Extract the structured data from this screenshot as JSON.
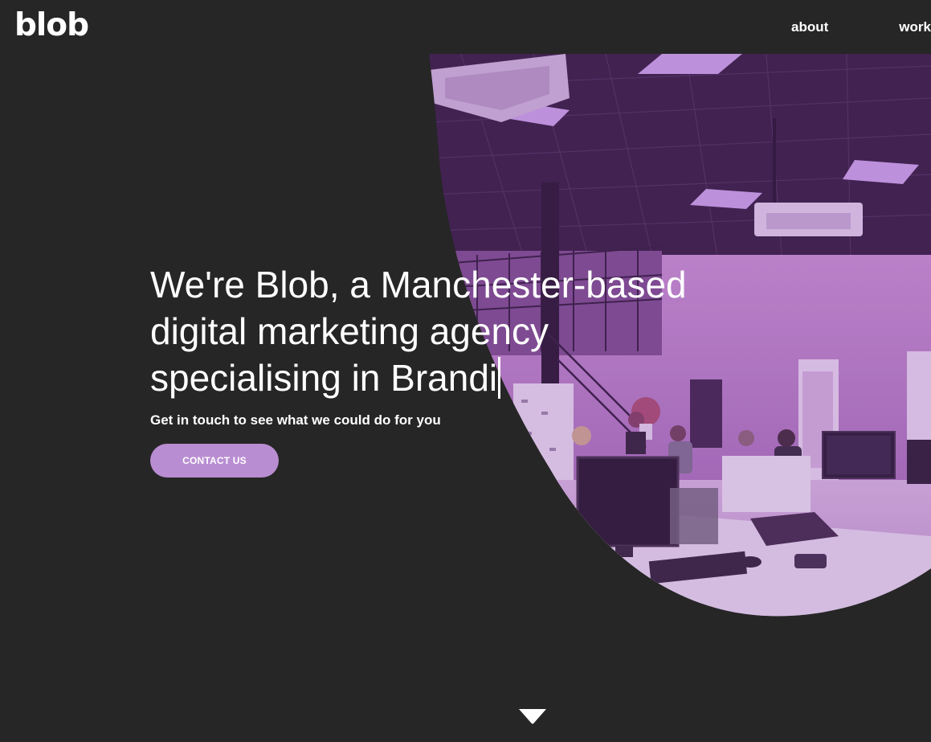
{
  "header": {
    "logo_text": "blob",
    "nav": [
      {
        "label": "about"
      },
      {
        "label": "work"
      }
    ]
  },
  "hero": {
    "headline": {
      "line1": "We're Blob, a Manchester-based",
      "line2": "digital marketing agency",
      "line3": "specialising in Brandi"
    },
    "subheading": "Get in touch to see what we could do for you",
    "cta_label": "CONTACT US",
    "image_tint": "#8e4fb0",
    "scroll_icon": "chevron-down-icon"
  },
  "colors": {
    "background": "#262626",
    "accent": "#b98dd2",
    "text": "#ffffff"
  }
}
